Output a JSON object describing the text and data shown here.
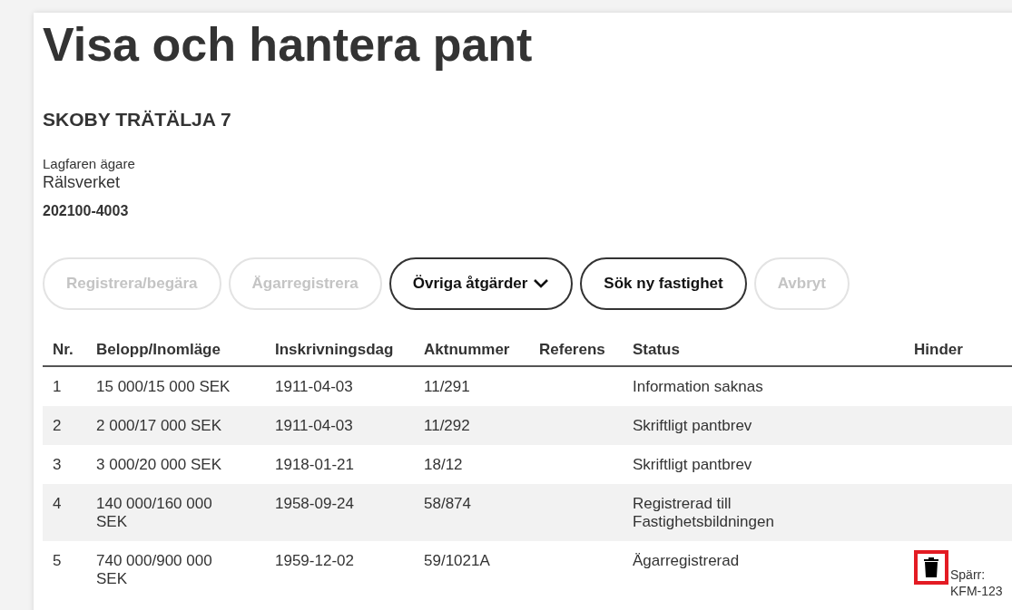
{
  "page": {
    "title": "Visa och hantera pant"
  },
  "property": {
    "name": "SKOBY TRÄTÄLJA 7",
    "owner_label": "Lagfaren ägare",
    "owner_name": "Rälsverket",
    "owner_id": "202100-4003"
  },
  "actions": [
    {
      "label": "Registrera/begära",
      "disabled": true,
      "dropdown": false
    },
    {
      "label": "Ägarregistrera",
      "disabled": true,
      "dropdown": false
    },
    {
      "label": "Övriga åtgärder",
      "disabled": false,
      "dropdown": true
    },
    {
      "label": "Sök ny fastighet",
      "disabled": false,
      "dropdown": false
    },
    {
      "label": "Avbryt",
      "disabled": true,
      "dropdown": false
    }
  ],
  "table": {
    "columns": [
      "Nr.",
      "Belopp/Inomläge",
      "Inskrivningsdag",
      "Aktnummer",
      "Referens",
      "Status",
      "Hinder"
    ],
    "rows": [
      {
        "nr": "1",
        "belopp": "15 000/15 000 SEK",
        "inskrivningsdag": "1911-04-03",
        "aktnummer": "11/291",
        "referens": "",
        "status": "Information saknas"
      },
      {
        "nr": "2",
        "belopp": "2 000/17 000 SEK",
        "inskrivningsdag": "1911-04-03",
        "aktnummer": "11/292",
        "referens": "",
        "status": "Skriftligt pantbrev"
      },
      {
        "nr": "3",
        "belopp": "3 000/20 000 SEK",
        "inskrivningsdag": "1918-01-21",
        "aktnummer": "18/12",
        "referens": "",
        "status": "Skriftligt pantbrev"
      },
      {
        "nr": "4",
        "belopp": "140 000/160 000 SEK",
        "inskrivningsdag": "1958-09-24",
        "aktnummer": "58/874",
        "referens": "",
        "status": "Registrerad till Fastighetsbildningen"
      },
      {
        "nr": "5",
        "belopp": "740 000/900 000 SEK",
        "inskrivningsdag": "1959-12-02",
        "aktnummer": "59/1021A",
        "referens": "",
        "status": "Ägarregistrerad",
        "hinder": {
          "text": "Spärr: KFM-123",
          "highlighted": true
        }
      }
    ]
  }
}
